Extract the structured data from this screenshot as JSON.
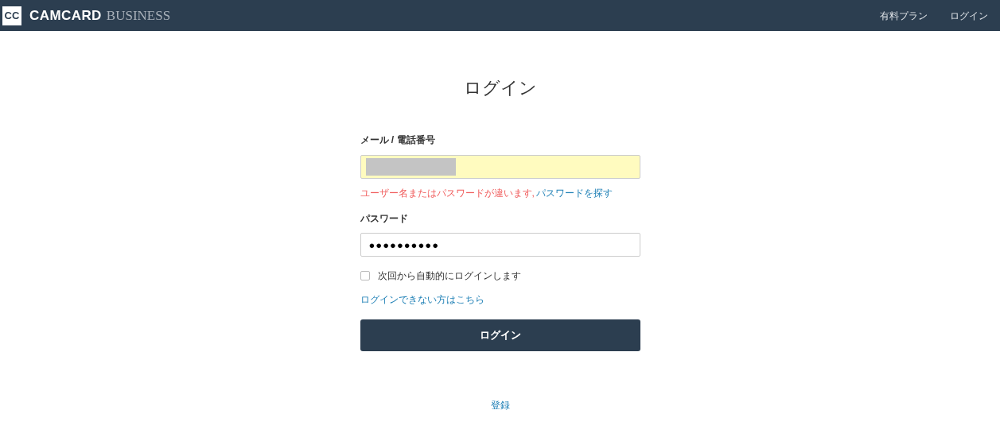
{
  "header": {
    "logo_mark": "CC",
    "brand": "CAMCARD",
    "brand_suffix": "BUSINESS",
    "nav": [
      "有料プラン",
      "ログイン"
    ]
  },
  "title": "ログイン",
  "form": {
    "email": {
      "label": "メール / 電話番号",
      "redacted": true,
      "error": "ユーザー名またはパスワードが違います,",
      "error_link": "パスワードを探す"
    },
    "password": {
      "label": "パスワード",
      "value": "●●●●●●●●●●"
    },
    "remember": {
      "label": "次回から自動的にログインします",
      "checked": false
    },
    "help_link": "ログインできない方はこちら",
    "submit": "ログイン"
  },
  "register_link": "登録"
}
